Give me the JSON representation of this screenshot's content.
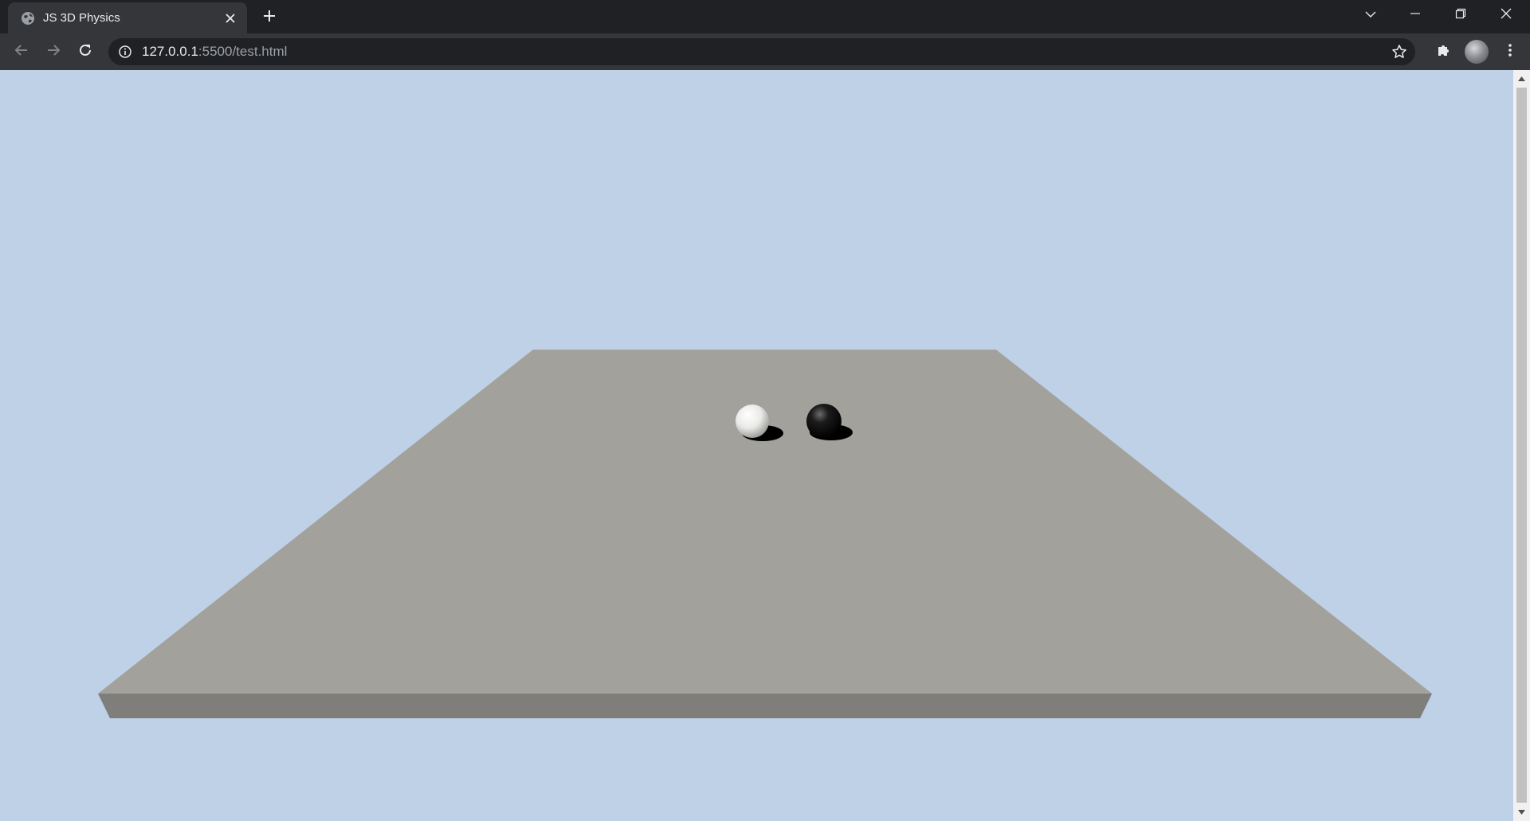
{
  "browser": {
    "tab": {
      "title": "JS 3D Physics",
      "favicon": "globe-icon",
      "close_icon": "close-icon"
    },
    "new_tab_icon": "plus-icon",
    "window_controls": [
      "tab-search-icon",
      "minimize-icon",
      "restore-icon",
      "close-window-icon"
    ],
    "toolbar": {
      "back_icon": "back-arrow-icon",
      "forward_icon": "forward-arrow-icon",
      "reload_icon": "reload-icon",
      "site_info_icon": "info-icon",
      "url_host": "127.0.0.1",
      "url_rest": ":5500/test.html",
      "bookmark_icon": "star-icon",
      "extensions_icon": "puzzle-icon",
      "profile_icon": "avatar",
      "menu_icon": "kebab-menu-icon"
    }
  },
  "scene": {
    "background_color": "#bed1e6",
    "plane_top_color": "#a3a19c",
    "plane_edge_color": "#7f7e7b",
    "spheres": [
      {
        "name": "white-sphere",
        "color": "#f2f2f2"
      },
      {
        "name": "black-sphere",
        "color": "#0a0a0a"
      }
    ]
  },
  "scrollbar": {
    "up_icon": "scroll-up-arrow-icon",
    "down_icon": "scroll-down-arrow-icon"
  }
}
